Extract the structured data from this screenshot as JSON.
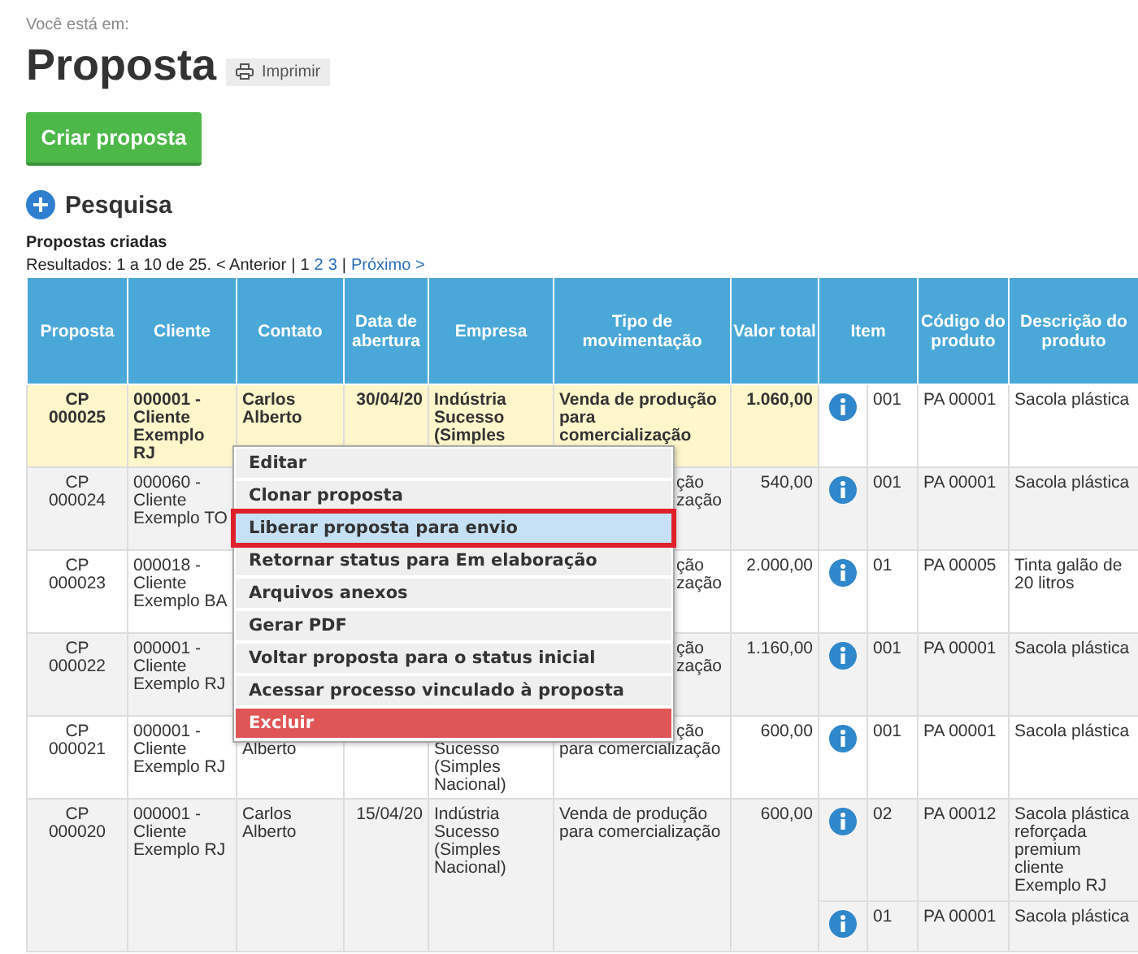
{
  "breadcrumb": "Você está em:",
  "title": "Proposta",
  "print_button": "Imprimir",
  "create_button": "Criar proposta",
  "search_toggle": "Pesquisa",
  "section_title": "Propostas criadas",
  "pagination": {
    "summary": "Resultados: 1 a 10 de 25.",
    "previous": "< Anterior",
    "separators": [
      "|",
      "|"
    ],
    "pages": [
      {
        "label": "1",
        "selected": true
      },
      {
        "label": "2",
        "selected": false
      },
      {
        "label": "3",
        "selected": false
      }
    ],
    "next": "Próximo >"
  },
  "table": {
    "columns": [
      "Proposta",
      "Cliente",
      "Contato",
      "Data de abertura",
      "Empresa",
      "Tipo de movimentação",
      "Valor total",
      "Item",
      "Código do produto",
      "Descrição do produto"
    ],
    "rows": [
      {
        "selected": true,
        "proposta": "CP 000025",
        "cliente": "000001 - Cliente Exemplo RJ",
        "contato": "Carlos Alberto",
        "data": "30/04/20",
        "empresa": "Indústria Sucesso (Simples",
        "tipo": "Venda de produção para comercialização",
        "valor": "1.060,00",
        "items": [
          {
            "item": "001",
            "codigo": "PA 00001",
            "descricao": "Sacola plástica"
          }
        ]
      },
      {
        "selected": false,
        "proposta": "CP 000024",
        "cliente": "000060 - Cliente Exemplo TO",
        "menu_overlap": true,
        "tipo": [
          {
            "text": "ção",
            "kind": "tail"
          },
          {
            "text": "zação",
            "kind": "tail"
          }
        ],
        "valor": "540,00",
        "items": [
          {
            "item": "001",
            "codigo": "PA 00001",
            "descricao": "Sacola plástica"
          }
        ]
      },
      {
        "selected": false,
        "proposta": "CP 000023",
        "cliente": "000018 - Cliente Exemplo BA",
        "menu_overlap": true,
        "tipo": [
          {
            "text": "ção",
            "kind": "tail"
          },
          {
            "text": "zação",
            "kind": "tail"
          }
        ],
        "valor": "2.000,00",
        "items": [
          {
            "item": "01",
            "codigo": "PA 00005",
            "descricao": "Tinta galão de 20 litros"
          }
        ]
      },
      {
        "selected": false,
        "proposta": "CP 000022",
        "cliente": "000001 - Cliente Exemplo RJ",
        "menu_overlap": true,
        "tipo": [
          {
            "text": "ção",
            "kind": "tail"
          },
          {
            "text": "zação",
            "kind": "tail"
          }
        ],
        "valor": "1.160,00",
        "items": [
          {
            "item": "001",
            "codigo": "PA 00001",
            "descricao": "Sacola plástica"
          }
        ]
      },
      {
        "selected": false,
        "proposta": "CP 000021",
        "cliente": "000001 - Cliente Exemplo RJ",
        "menu_overlap": true,
        "contato": "Alberto",
        "empresa": "Sucesso (Simples Nacional)",
        "tipo": [
          {
            "text": "ção",
            "kind": "tail"
          },
          {
            "text": "para comercialização",
            "kind": "full"
          }
        ],
        "valor": "600,00",
        "items": [
          {
            "item": "001",
            "codigo": "PA 00001",
            "descricao": "Sacola plástica"
          }
        ]
      },
      {
        "selected": false,
        "proposta": "CP 000020",
        "cliente": "000001 - Cliente Exemplo RJ",
        "contato": "Carlos Alberto",
        "data": "15/04/20",
        "empresa": "Indústria Sucesso (Simples Nacional)",
        "tipo": "Venda de produção para comercialização",
        "valor": "600,00",
        "items": [
          {
            "item": "02",
            "codigo": "PA 00012",
            "descricao": "Sacola plástica reforçada premium cliente Exemplo RJ"
          },
          {
            "item": "01",
            "codigo": "PA 00001",
            "descricao": "Sacola plástica"
          }
        ]
      }
    ]
  },
  "context_menu": [
    {
      "label": "Editar",
      "kind": "normal",
      "selected": false
    },
    {
      "label": "Clonar proposta",
      "kind": "normal",
      "selected": false
    },
    {
      "label": "Liberar proposta para envio",
      "kind": "normal",
      "selected": true
    },
    {
      "label": "Retornar status para Em elaboração",
      "kind": "normal",
      "selected": false
    },
    {
      "label": "Arquivos anexos",
      "kind": "normal",
      "selected": false
    },
    {
      "label": "Gerar PDF",
      "kind": "normal",
      "selected": false
    },
    {
      "label": "Voltar proposta para o status inicial",
      "kind": "normal",
      "selected": false
    },
    {
      "label": "Acessar processo vinculado à proposta",
      "kind": "normal",
      "selected": false
    },
    {
      "label": "Excluir",
      "kind": "danger",
      "selected": false
    }
  ]
}
